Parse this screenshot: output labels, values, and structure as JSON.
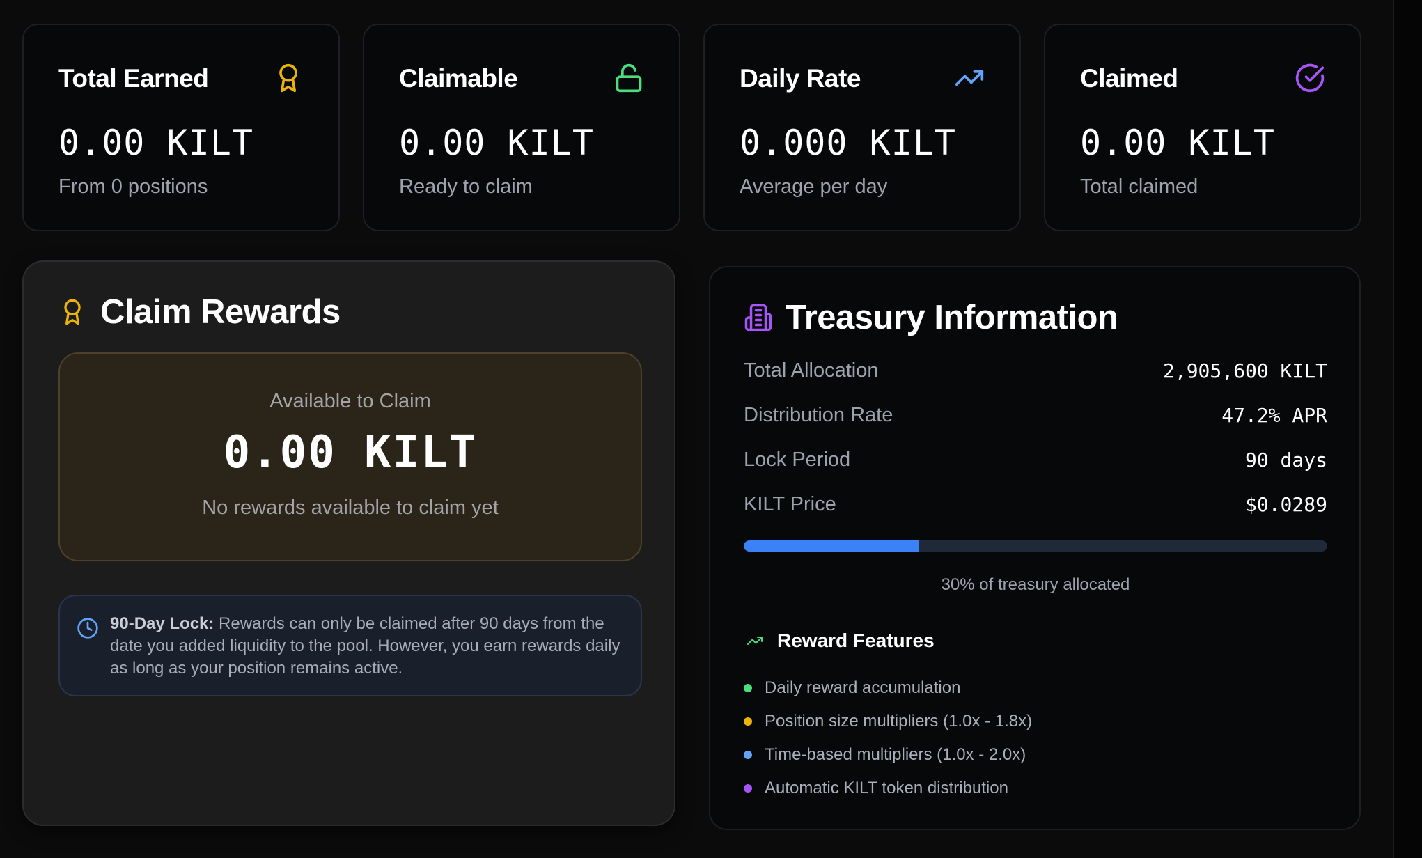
{
  "stats": [
    {
      "title": "Total Earned",
      "value": "0.00 KILT",
      "sub": "From 0 positions",
      "icon": "award-icon",
      "icon_color": "#eab308"
    },
    {
      "title": "Claimable",
      "value": "0.00 KILT",
      "sub": "Ready to claim",
      "icon": "unlock-icon",
      "icon_color": "#4ade80"
    },
    {
      "title": "Daily Rate",
      "value": "0.000 KILT",
      "sub": "Average per day",
      "icon": "trending-up-icon",
      "icon_color": "#60a5fa"
    },
    {
      "title": "Claimed",
      "value": "0.00 KILT",
      "sub": "Total claimed",
      "icon": "check-circle-icon",
      "icon_color": "#a855f7"
    }
  ],
  "claim": {
    "heading": "Claim Rewards",
    "available_label": "Available to Claim",
    "available_amount": "0.00 KILT",
    "available_note": "No rewards available to claim yet",
    "lock_title": "90-Day Lock:",
    "lock_text": " Rewards can only be claimed after 90 days from the date you added liquidity to the pool. However, you earn rewards daily as long as your position remains active."
  },
  "treasury": {
    "heading": "Treasury Information",
    "rows": [
      {
        "label": "Total Allocation",
        "value": "2,905,600 KILT"
      },
      {
        "label": "Distribution Rate",
        "value": "47.2% APR"
      },
      {
        "label": "Lock Period",
        "value": "90 days"
      },
      {
        "label": "KILT Price",
        "value": "$0.0289"
      }
    ],
    "allocated_percent": 30,
    "progress_label": "30% of treasury allocated",
    "features_title": "Reward Features",
    "features": [
      {
        "text": "Daily reward accumulation",
        "color": "#4ade80"
      },
      {
        "text": "Position size multipliers (1.0x - 1.8x)",
        "color": "#eab308"
      },
      {
        "text": "Time-based multipliers (1.0x - 2.0x)",
        "color": "#60a5fa"
      },
      {
        "text": "Automatic KILT token distribution",
        "color": "#a855f7"
      }
    ]
  },
  "colors": {
    "accent_blue": "#3b82f6",
    "gold": "#eab308",
    "green": "#4ade80",
    "purple": "#a855f7"
  }
}
